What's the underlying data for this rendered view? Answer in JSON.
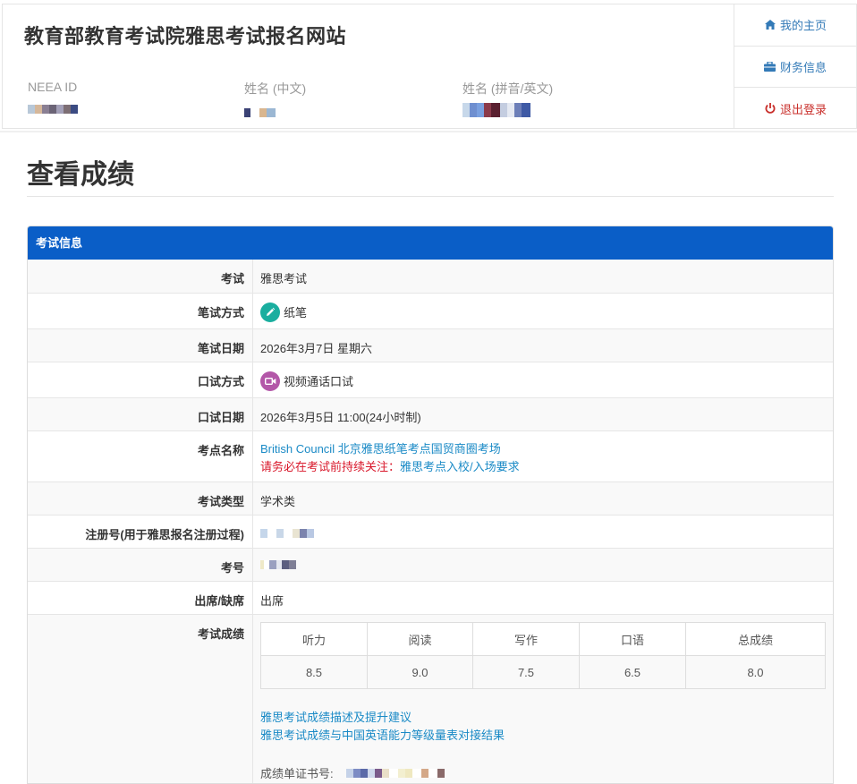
{
  "header": {
    "site_title": "教育部教育考试院雅思考试报名网站",
    "fields": [
      {
        "label": "NEEA ID"
      },
      {
        "label": "姓名 (中文)"
      },
      {
        "label": "姓名 (拼音/英文)"
      }
    ]
  },
  "nav": {
    "home": "我的主页",
    "finance": "财务信息",
    "logout": "退出登录"
  },
  "page_title": "查看成绩",
  "panel": {
    "heading": "考试信息",
    "rows": {
      "exam": {
        "label": "考试",
        "value": "雅思考试"
      },
      "written_mode": {
        "label": "笔试方式",
        "value": "纸笔"
      },
      "written_date": {
        "label": "笔试日期",
        "value": "2026年3月7日 星期六"
      },
      "speaking_mode": {
        "label": "口试方式",
        "value": "视频通话口试"
      },
      "speaking_date": {
        "label": "口试日期",
        "value": "2026年3月5日 11:00(24小时制)"
      },
      "venue": {
        "label": "考点名称",
        "value": "British Council 北京雅思纸笔考点国贸商圈考场",
        "warn": "请务必在考试前持续关注：",
        "warn_link": "雅思考点入校/入场要求"
      },
      "exam_type": {
        "label": "考试类型",
        "value": "学术类"
      },
      "reg_no": {
        "label": "注册号(用于雅思报名注册过程)"
      },
      "candidate_no": {
        "label": "考号"
      },
      "attendance": {
        "label": "出席/缺席",
        "value": "出席"
      },
      "scores": {
        "label": "考试成绩"
      }
    },
    "scores": {
      "headers": [
        "听力",
        "阅读",
        "写作",
        "口语",
        "总成绩"
      ],
      "values": [
        "8.5",
        "9.0",
        "7.5",
        "6.5",
        "8.0"
      ]
    },
    "links": {
      "desc": "雅思考试成绩描述及提升建议",
      "mapping": "雅思考试成绩与中国英语能力等级量表对接结果"
    },
    "trf_label": "成绩单证书号:"
  },
  "colors": {
    "panel_header": "#0a5ec7",
    "link": "#1a8ac6",
    "warn": "#d9182b",
    "nav_link": "#337ab7",
    "logout": "#c9302c"
  }
}
